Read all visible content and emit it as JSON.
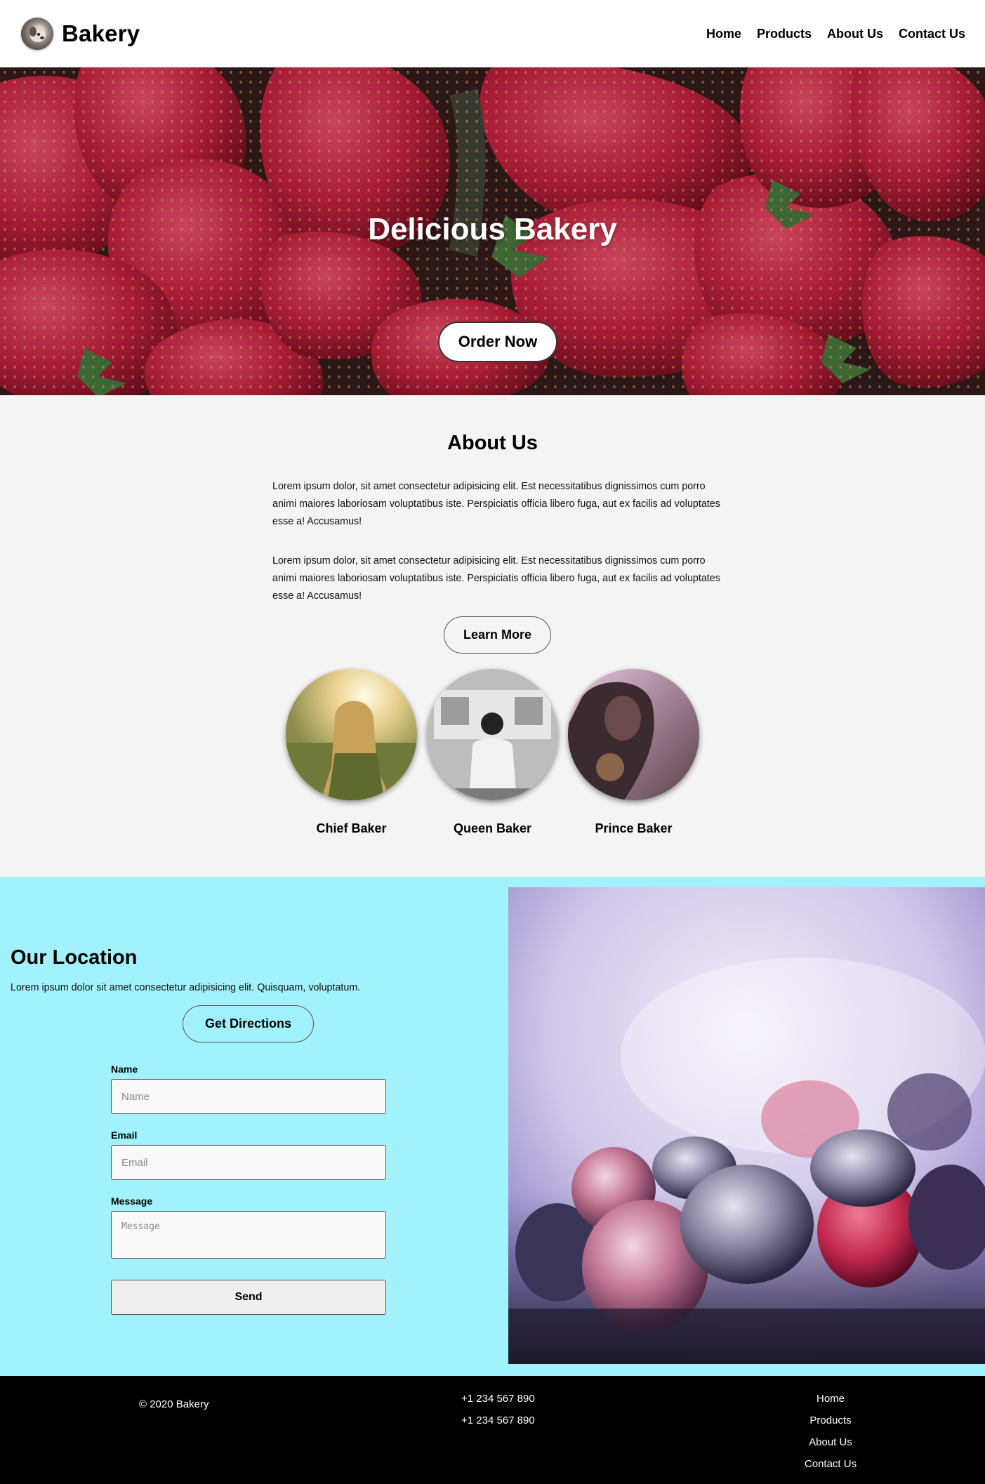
{
  "brand": {
    "name": "Bakery",
    "logo_icon": "dog-avatar-icon"
  },
  "nav": {
    "items": [
      "Home",
      "Products",
      "About Us",
      "Contact Us"
    ]
  },
  "hero": {
    "title": "Delicious Bakery",
    "cta_label": "Order Now",
    "image": "strawberries-photo"
  },
  "about": {
    "title": "About Us",
    "paragraph_1": "Lorem ipsum dolor, sit amet consectetur adipisicing elit. Est necessitatibus dignissimos cum porro animi maiores laboriosam voluptatibus iste. Perspiciatis officia libero fuga, aut ex facilis ad voluptates esse a! Accusamus!",
    "paragraph_2": "Lorem ipsum dolor, sit amet consectetur adipisicing elit. Est necessitatibus dignissimos cum porro animi maiores laboriosam voluptatibus iste. Perspiciatis officia libero fuga, aut ex facilis ad voluptates esse a! Accusamus!",
    "learn_more_label": "Learn More",
    "team": [
      {
        "name": "Chief Baker",
        "photo": "woman-in-field-photo"
      },
      {
        "name": "Queen Baker",
        "photo": "woman-in-subway-photo"
      },
      {
        "name": "Prince Baker",
        "photo": "woman-portrait-photo"
      }
    ]
  },
  "location": {
    "title": "Our Location",
    "text": "Lorem ipsum dolor sit amet consectetur adipisicing elit. Quisquam, voluptatum.",
    "directions_label": "Get Directions",
    "form": {
      "name_label": "Name",
      "name_placeholder": "Name",
      "email_label": "Email",
      "email_placeholder": "Email",
      "message_label": "Message",
      "message_placeholder": "Message",
      "send_label": "Send"
    },
    "image": "frozen-berries-photo"
  },
  "footer": {
    "copyright": "© 2020 Bakery",
    "phones": [
      "+1 234 567 890",
      "+1 234 567 890"
    ],
    "links": [
      "Home",
      "Products",
      "About Us",
      "Contact Us"
    ]
  },
  "colors": {
    "location_bg": "#a1f2fd",
    "about_bg": "#f4f4f4",
    "footer_bg": "#000000"
  }
}
